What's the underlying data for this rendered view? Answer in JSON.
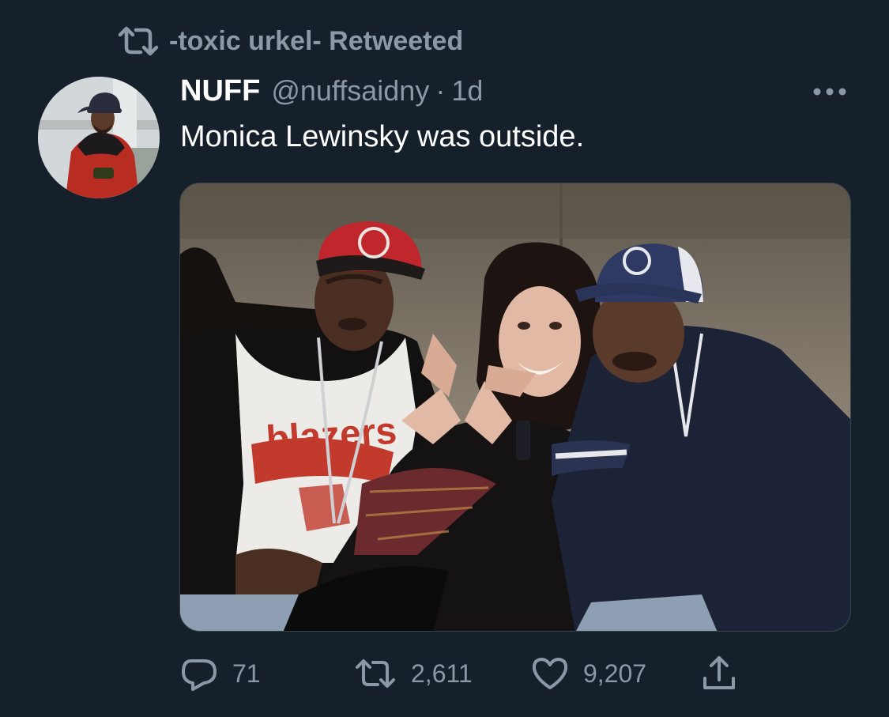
{
  "retweet_banner": {
    "icon": "retweet-icon",
    "text": "-toxic urkel- Retweeted"
  },
  "tweet": {
    "author_name": "NUFF",
    "author_handle": "@nuffsaidny",
    "separator": "·",
    "timestamp": "1d",
    "text": "Monica Lewinsky was outside.",
    "avatar_icon": "avatar",
    "more_icon": "more-horizontal-icon",
    "media": {
      "type": "photo",
      "jersey_text": "blazers"
    }
  },
  "actions": {
    "reply": {
      "icon": "reply-icon",
      "count": "71"
    },
    "retweet": {
      "icon": "retweet-icon",
      "count": "2,611"
    },
    "like": {
      "icon": "heart-icon",
      "count": "9,207"
    },
    "share": {
      "icon": "share-icon"
    }
  },
  "colors": {
    "background": "#15202b",
    "secondary_text": "#8b98a5",
    "primary_text": "#ffffff"
  }
}
